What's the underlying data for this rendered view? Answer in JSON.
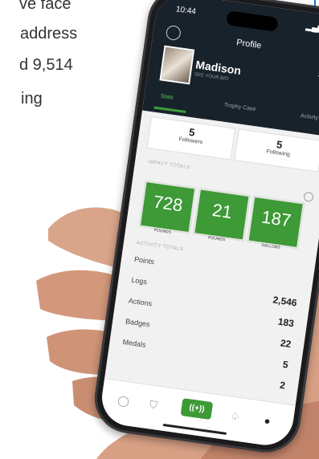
{
  "background": {
    "line1": "ve face",
    "line2": "address",
    "line3": "d 9,514",
    "line4": "ing"
  },
  "status": {
    "time": "10:44",
    "icons": "▂▄▆ ◈"
  },
  "header": {
    "title": "Profile"
  },
  "user": {
    "name": "Madison",
    "subtitle": "SEE YOUR BIO"
  },
  "tabs": [
    {
      "label": "Stats"
    },
    {
      "label": "Trophy Case"
    },
    {
      "label": "Activity"
    }
  ],
  "follow": {
    "followers_count": "5",
    "followers_label": "Followers",
    "following_count": "5",
    "following_label": "Following"
  },
  "impact": {
    "section": "IMPACT TOTALS",
    "items": [
      {
        "value": "728",
        "label": "POUNDS"
      },
      {
        "value": "21",
        "label": "POUNDS"
      },
      {
        "value": "187",
        "label": "GALLONS"
      }
    ]
  },
  "activity": {
    "section": "ACTIVITY TOTALS",
    "rows": [
      {
        "label": "Points",
        "value": ""
      },
      {
        "label": "Logs",
        "value": "2,546"
      },
      {
        "label": "Actions",
        "value": "183"
      },
      {
        "label": "Badges",
        "value": "22"
      },
      {
        "label": "Medals",
        "value": "5"
      },
      {
        "label": "",
        "value": "2"
      }
    ]
  },
  "nav": {
    "main_label": "((+))"
  },
  "colors": {
    "accent": "#3d9a36",
    "header_bg": "#18222b"
  }
}
